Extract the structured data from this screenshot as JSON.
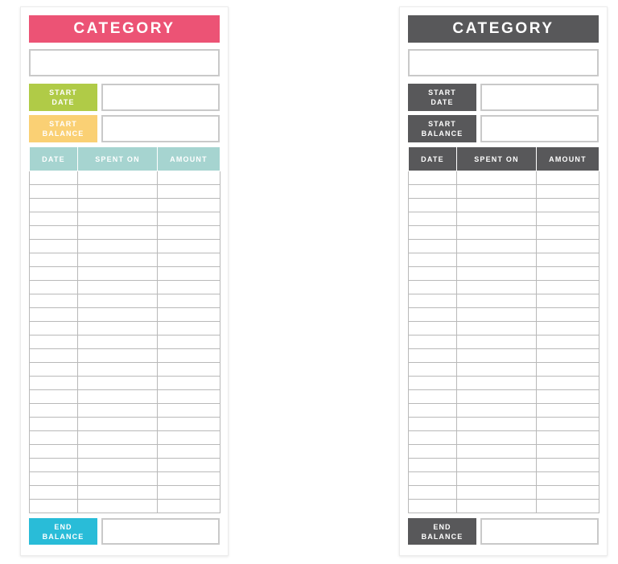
{
  "page": {
    "background": "#ffffff",
    "input_border_color": "#c9c9c9",
    "grid_line_color": "#b9b9b9"
  },
  "sheets": [
    {
      "id": "colored",
      "variant": "colored",
      "title": "CATEGORY",
      "title_bg": "#ec5375",
      "category_value": "",
      "category_placeholder": "",
      "start_date": {
        "label_line1": "START",
        "label_line2": "DATE",
        "label_bg": "#b0cb47",
        "value": ""
      },
      "start_balance": {
        "label_line1": "START",
        "label_line2": "BALANCE",
        "label_bg": "#fad074",
        "value": ""
      },
      "table": {
        "header_bg": "#a6d4d0",
        "columns": [
          "DATE",
          "SPENT ON",
          "AMOUNT"
        ],
        "row_count": 25,
        "rows": []
      },
      "end_balance": {
        "label_line1": "END",
        "label_line2": "BALANCE",
        "label_bg": "#29bcd8",
        "value": ""
      }
    },
    {
      "id": "grayscale",
      "variant": "grayscale",
      "title": "CATEGORY",
      "title_bg": "#58585a",
      "category_value": "",
      "category_placeholder": "",
      "start_date": {
        "label_line1": "START",
        "label_line2": "DATE",
        "label_bg": "#58585a",
        "value": ""
      },
      "start_balance": {
        "label_line1": "START",
        "label_line2": "BALANCE",
        "label_bg": "#58585a",
        "value": ""
      },
      "table": {
        "header_bg": "#58585a",
        "columns": [
          "DATE",
          "SPENT ON",
          "AMOUNT"
        ],
        "row_count": 25,
        "rows": []
      },
      "end_balance": {
        "label_line1": "END",
        "label_line2": "BALANCE",
        "label_bg": "#58585a",
        "value": ""
      }
    }
  ]
}
